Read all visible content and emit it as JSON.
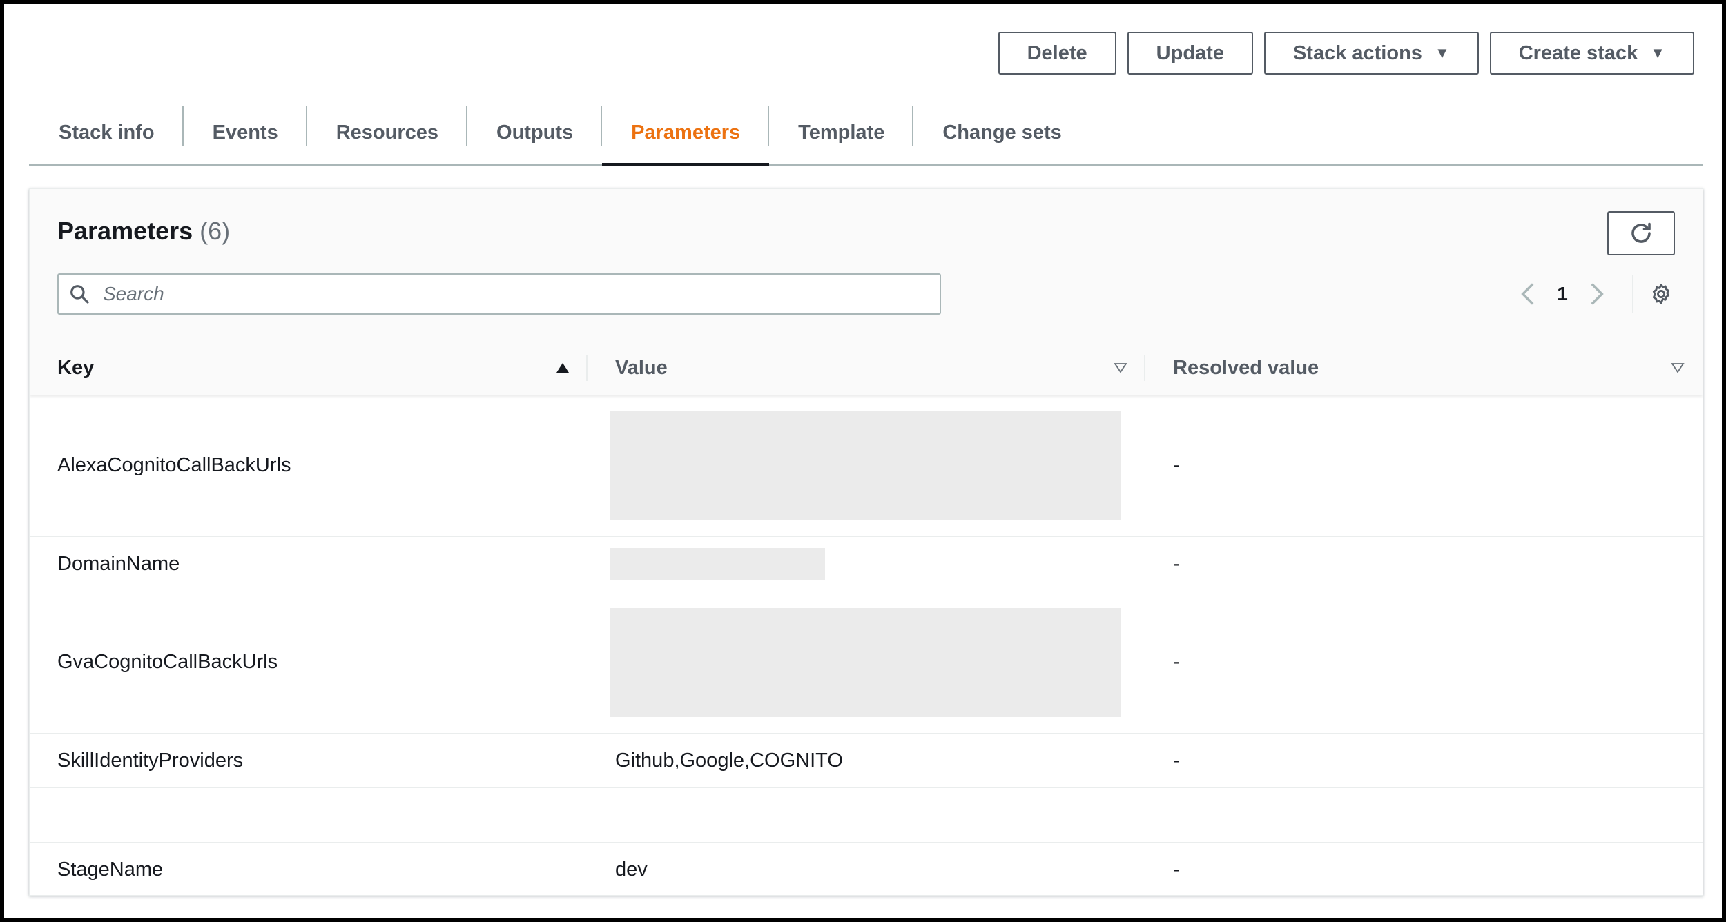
{
  "actions": {
    "delete": "Delete",
    "update": "Update",
    "stack_actions": "Stack actions",
    "create_stack": "Create stack"
  },
  "tabs": [
    {
      "label": "Stack info",
      "active": false
    },
    {
      "label": "Events",
      "active": false
    },
    {
      "label": "Resources",
      "active": false
    },
    {
      "label": "Outputs",
      "active": false
    },
    {
      "label": "Parameters",
      "active": true
    },
    {
      "label": "Template",
      "active": false
    },
    {
      "label": "Change sets",
      "active": false
    }
  ],
  "panel": {
    "title": "Parameters",
    "count": "(6)",
    "search_placeholder": "Search",
    "page": "1"
  },
  "table": {
    "headers": {
      "key": "Key",
      "value": "Value",
      "resolved": "Resolved value"
    },
    "rows": [
      {
        "key": "AlexaCognitoCallBackUrls",
        "value": "",
        "resolved": "-"
      },
      {
        "key": "DomainName",
        "value": "",
        "resolved": "-"
      },
      {
        "key": "GvaCognitoCallBackUrls",
        "value": "",
        "resolved": "-"
      },
      {
        "key": "SkillIdentityProviders",
        "value": "Github,Google,COGNITO",
        "resolved": "-"
      },
      {
        "key": "",
        "value": "",
        "resolved": ""
      },
      {
        "key": "StageName",
        "value": "dev",
        "resolved": "-"
      }
    ]
  },
  "colors": {
    "accent": "#ec7211",
    "text": "#16191f",
    "muted": "#545b64",
    "border": "#aab7b8"
  }
}
